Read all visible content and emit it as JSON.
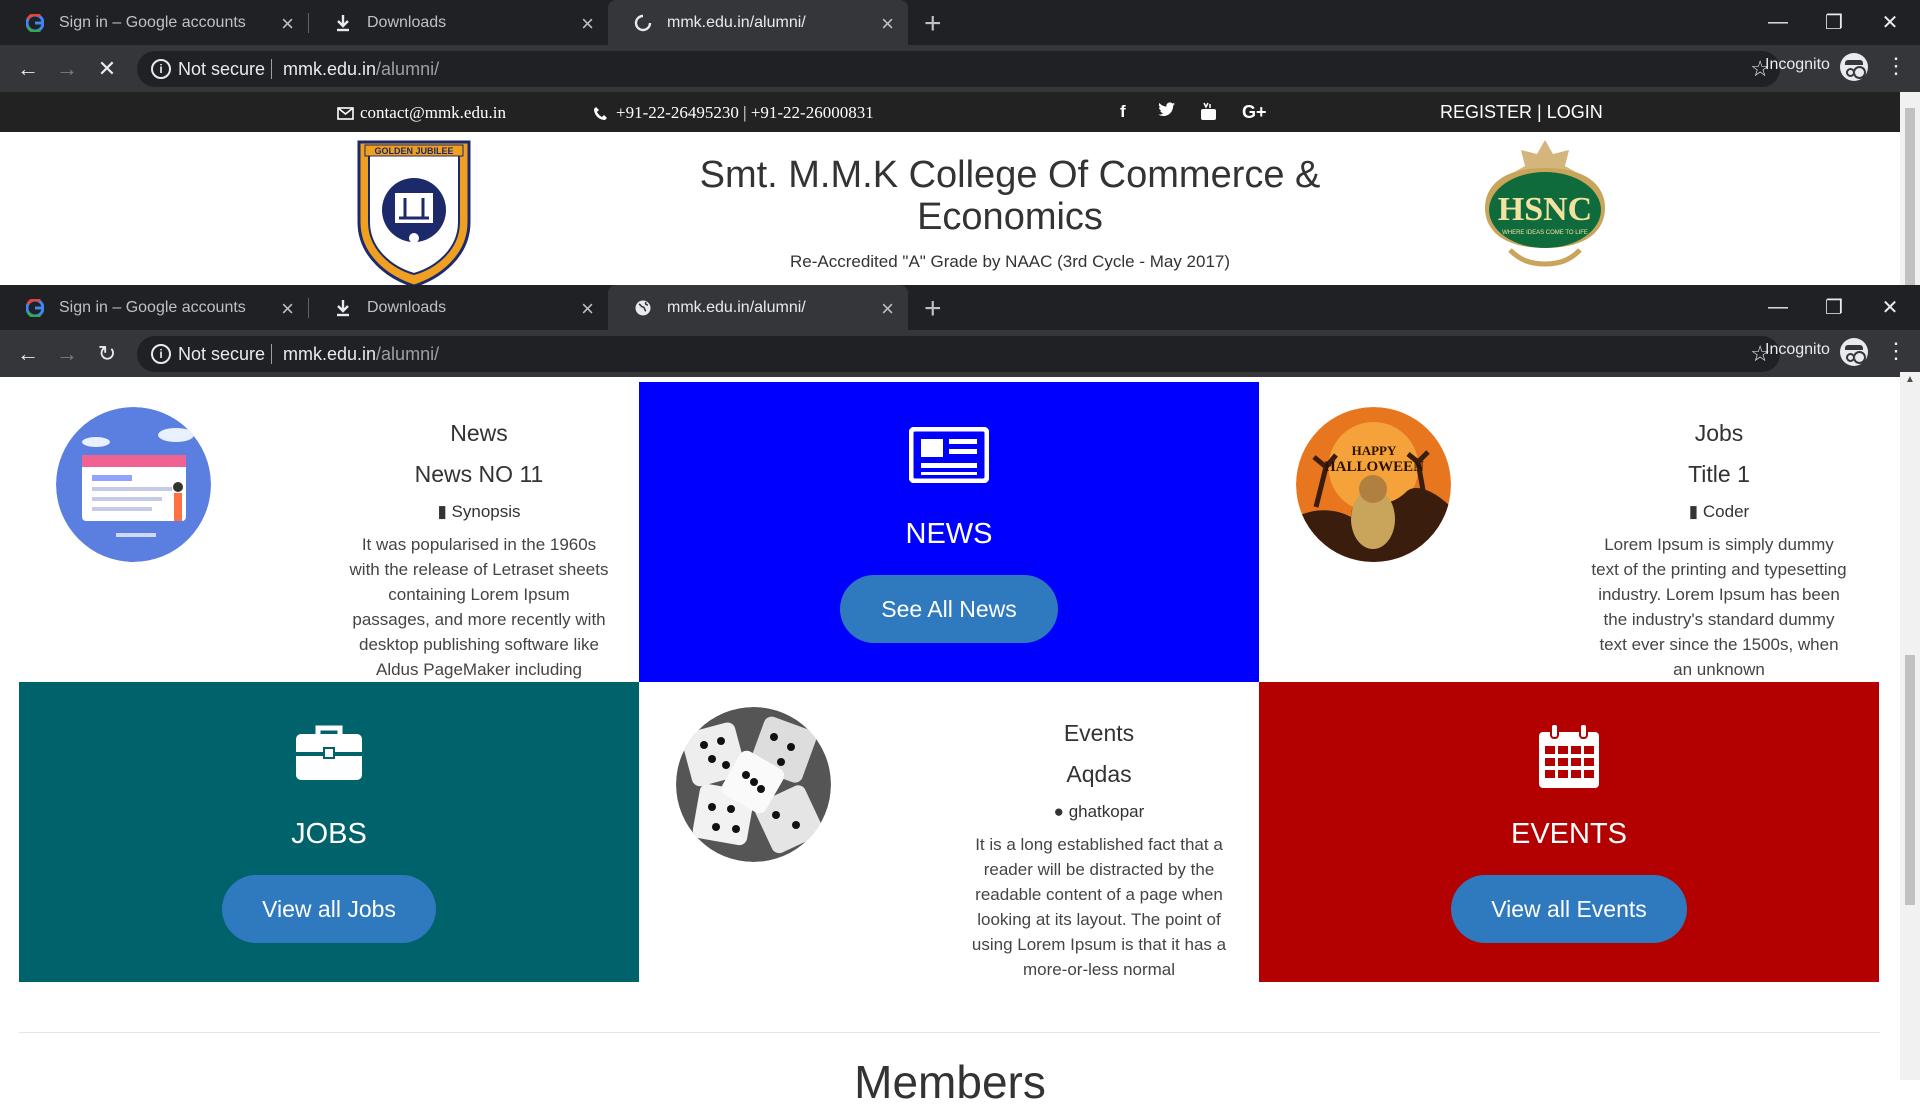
{
  "browser_top": {
    "tabs": [
      {
        "title": "Sign in – Google accounts",
        "icon": "google-icon"
      },
      {
        "title": "Downloads",
        "icon": "download-icon"
      },
      {
        "title": "mmk.edu.in/alumni/",
        "icon": "loading-spinner-icon",
        "active": true
      }
    ],
    "not_secure": "Not secure",
    "url_host": "mmk.edu.in",
    "url_path": "/alumni/",
    "incognito": "Incognito"
  },
  "browser_bottom": {
    "tabs": [
      {
        "title": "Sign in – Google accounts",
        "icon": "google-icon"
      },
      {
        "title": "Downloads",
        "icon": "download-icon"
      },
      {
        "title": "mmk.edu.in/alumni/",
        "icon": "globe-icon",
        "active": true
      }
    ],
    "not_secure": "Not secure",
    "url_host": "mmk.edu.in",
    "url_path": "/alumni/",
    "incognito": "Incognito"
  },
  "sitebar": {
    "email": "contact@mmk.edu.in",
    "phone": "+91-22-26495230 | +91-22-26000831",
    "social": [
      "facebook-icon",
      "twitter-icon",
      "youtube-icon",
      "google-plus-icon"
    ],
    "register_login": "REGISTER | LOGIN"
  },
  "header": {
    "college_name": "Smt. M.M.K College Of Commerce & Economics",
    "accreditation": "Re-Accredited \"A\" Grade by NAAC (3rd Cycle - May 2017)",
    "logo_left_text": "GOLDEN JUBILEE",
    "logo_right_text": "HSNC",
    "logo_right_tagline": "WHERE IDEAS COME TO LIFE"
  },
  "news_card": {
    "category": "News",
    "title": "News NO 11",
    "meta": "Synopsis",
    "description": "It was popularised in the 1960s with the release of Letraset sheets containing Lorem Ipsum passages, and more recently with desktop publishing software like Aldus PageMaker including"
  },
  "news_feature": {
    "label": "NEWS",
    "button": "See All News",
    "color": "#0000ff"
  },
  "jobs_card": {
    "category": "Jobs",
    "title": "Title 1",
    "meta": "Coder",
    "description": "Lorem Ipsum is simply dummy text of the printing and typesetting industry. Lorem Ipsum has been the industry's standard dummy text ever since the 1500s, when an unknown"
  },
  "jobs_feature": {
    "label": "JOBS",
    "button": "View all Jobs",
    "color": "#00636b"
  },
  "events_card": {
    "category": "Events",
    "title": "Aqdas",
    "meta": "ghatkopar",
    "description": "It is a long established fact that a reader will be distracted by the readable content of a page when looking at its layout. The point of using Lorem Ipsum is that it has a more-or-less normal"
  },
  "events_feature": {
    "label": "EVENTS",
    "button": "View all Events",
    "color": "#b30000"
  },
  "members_heading": "Members",
  "halloween_text": {
    "line1": "HAPPY",
    "line2": "HALLOWEEN"
  }
}
